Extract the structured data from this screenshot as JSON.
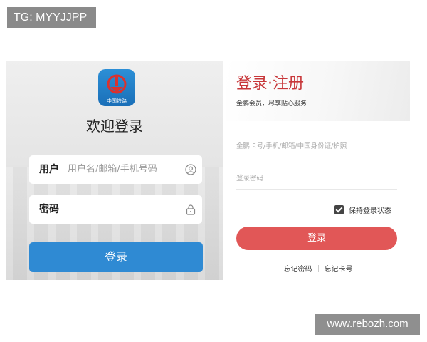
{
  "watermarks": {
    "tg": "TG: MYYJJPP",
    "site": "www.rebozh.com"
  },
  "left": {
    "logo_text": "中国铁路",
    "title": "欢迎登录",
    "user_label": "用户",
    "user_placeholder": "用户名/邮箱/手机号码",
    "user_icon": "person-icon",
    "password_label": "密码",
    "password_icon": "lock-icon",
    "login_button": "登录",
    "accent": "#2f8ad3"
  },
  "right": {
    "hero": "登录·注册",
    "subtitle": "金鹏会员，尽享贴心服务",
    "card_placeholder": "金鹏卡号/手机/邮箱/中国身份证/护照",
    "password_placeholder": "登录密码",
    "keep_login": "保持登录状态",
    "keep_login_checked": true,
    "login_button": "登录",
    "forgot_password": "忘记密码",
    "forgot_card": "忘记卡号",
    "accent": "#e15757"
  }
}
